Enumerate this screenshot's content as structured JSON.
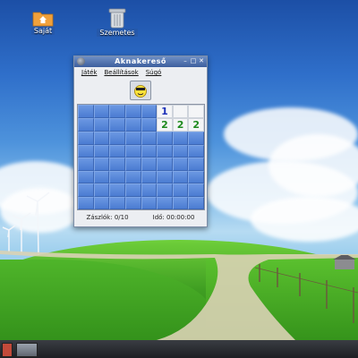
{
  "desktop": {
    "icons": [
      {
        "label": "Saját",
        "icon": "folder-home-icon"
      },
      {
        "label": "Szemetes",
        "icon": "trash-icon"
      }
    ]
  },
  "window": {
    "title": "Aknakereső",
    "menu": [
      "Játék",
      "Beállítások",
      "Súgó"
    ],
    "status": {
      "flags": "Zászlók: 0/10",
      "time": "Idő: 00:00:00"
    }
  },
  "board": {
    "rows": 8,
    "cols": 8,
    "revealed": [
      {
        "row": 0,
        "col": 5,
        "value": "1"
      },
      {
        "row": 0,
        "col": 6,
        "value": ""
      },
      {
        "row": 0,
        "col": 7,
        "value": ""
      },
      {
        "row": 1,
        "col": 5,
        "value": "2"
      },
      {
        "row": 1,
        "col": 6,
        "value": "2"
      },
      {
        "row": 1,
        "col": 7,
        "value": "2"
      }
    ]
  },
  "colors": {
    "number1": "#1b2fb8",
    "number2": "#1e8a1e",
    "tile": "#5b88d6"
  }
}
